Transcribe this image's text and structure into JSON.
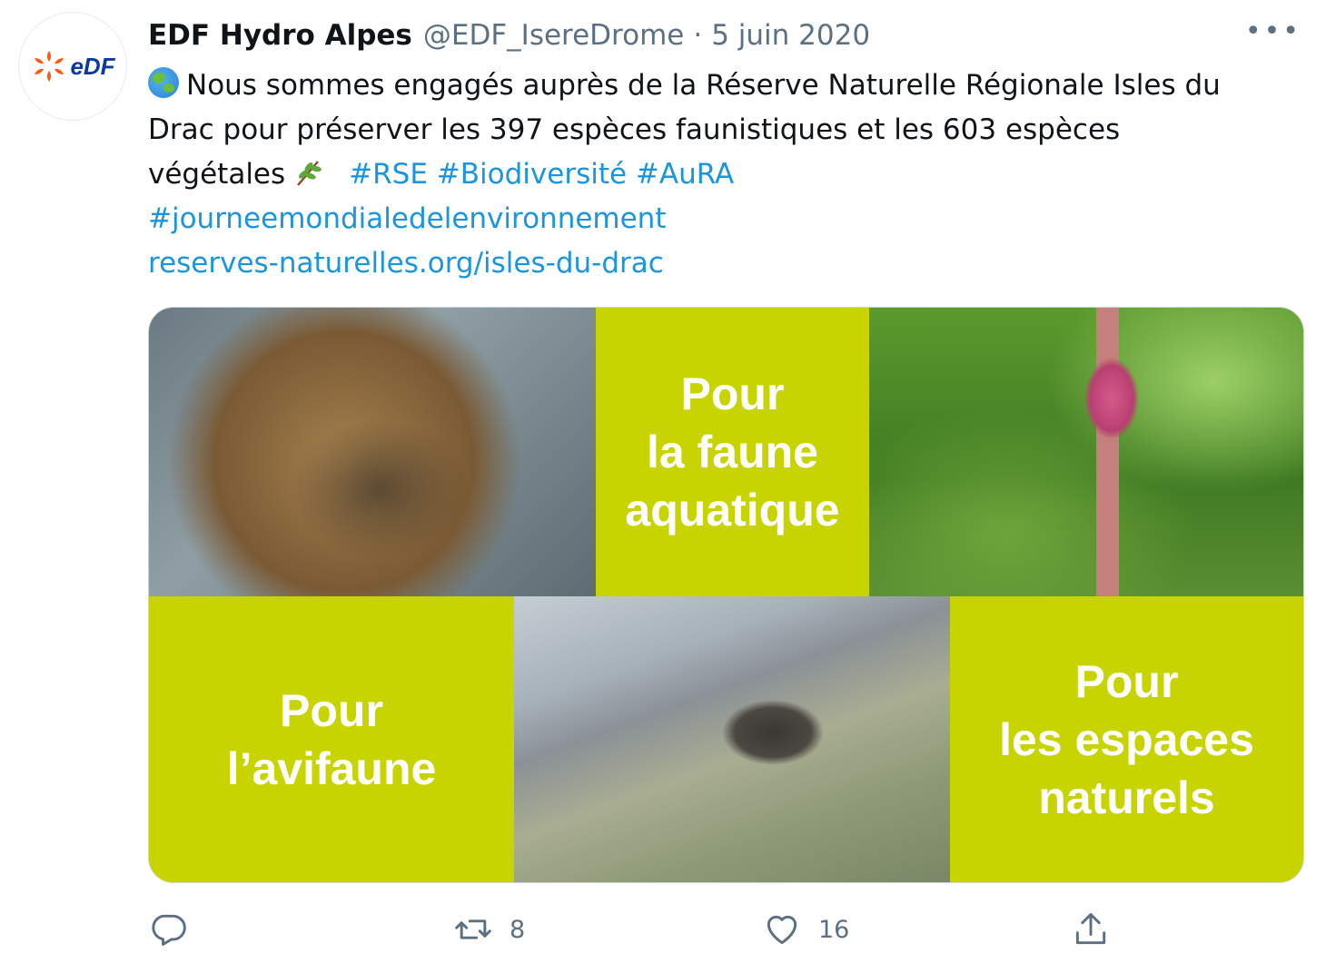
{
  "tweet": {
    "author_name": "EDF Hydro Alpes",
    "handle": "@EDF_IsereDrome",
    "separator": "·",
    "date": "5 juin 2020",
    "avatar_text": "eDF",
    "more_label": "•••",
    "text_line1": "Nous sommes engagés auprès de la Réserve Naturelle Régionale Isles du",
    "text_line2": "Drac pour préserver les 397 espèces faunistiques et les 603 espèces",
    "text_line3": "végétales",
    "hashtags": [
      "#RSE",
      "#Biodiversité",
      "#AuRA",
      "#journeemondialedelenvironnement"
    ],
    "link": "reserves-naturelles.org/isles-du-drac"
  },
  "media": {
    "tile_faune": [
      "Pour",
      "la faune",
      "aquatique"
    ],
    "tile_avifaune": [
      "Pour",
      "l’avifaune"
    ],
    "tile_espaces": [
      "Pour",
      "les espaces",
      "naturels"
    ],
    "accent_color": "#c8d400"
  },
  "actions": {
    "reply_count": "",
    "retweet_count": "8",
    "like_count": "16"
  },
  "icons": {
    "globe": "globe-emoji-icon",
    "herb": "herb-emoji-icon",
    "more": "more-icon",
    "reply": "reply-icon",
    "retweet": "retweet-icon",
    "like": "heart-icon",
    "share": "share-icon"
  },
  "colors": {
    "link": "#1b95e0",
    "secondary_text": "#5b7083",
    "brand_orange": "#fe5815",
    "brand_blue": "#0a3aa0"
  }
}
